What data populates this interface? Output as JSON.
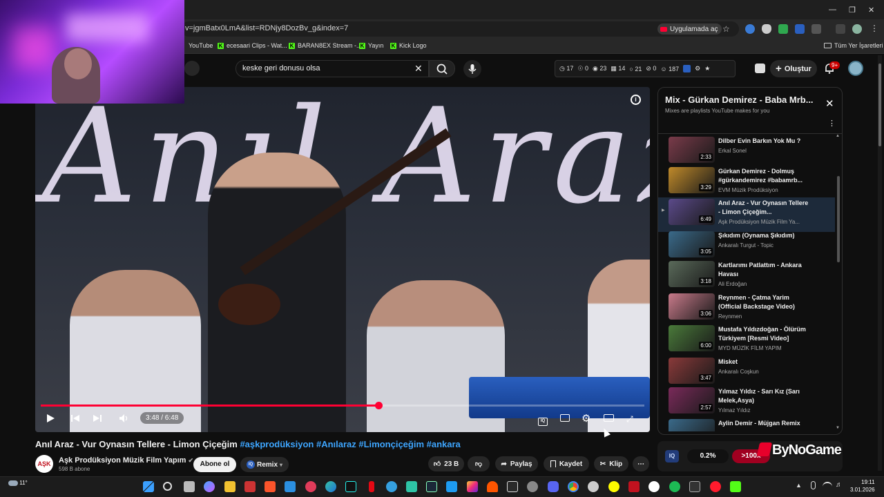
{
  "browser": {
    "url": "v=jgmBatx0LmA&list=RDNjy8DozBv_g&index=7",
    "open_in_app": "Uygulamada aç",
    "bookmarks": [
      "YouTube",
      "ecesaari Clips - Wat...",
      "BARAN8EX Stream -...",
      "Yayın",
      "Kick Logo"
    ],
    "all_bookmarks": "Tüm Yer İşaretleri"
  },
  "header": {
    "search_value": "keske geri donusu olsa",
    "stats": [
      "17",
      "0",
      "23",
      "14",
      "21",
      "0",
      "187"
    ],
    "create_label": "Oluştur",
    "notifications_count": "9+"
  },
  "video": {
    "title": "Anıl Araz - Vur Oynasın Tellere - Limon Çiçeğim",
    "hashtags": "#aşkprodüksiyon #Anılaraz #Limonçiçeğim #ankara",
    "overlay_text": "Anıl Araz",
    "time": "3:48 / 6:48",
    "progress_fraction": 0.559,
    "channel_logo": "AŞK",
    "channel_name": "Aşk Prodüksiyon Müzik Film Yapım",
    "subscribers": "598 B abone",
    "subscribe_label": "Abone ol",
    "remix_label": "Remix",
    "likes": "23 B",
    "share_label": "Paylaş",
    "save_label": "Kaydet",
    "clip_label": "Klip"
  },
  "playlist": {
    "title": "Mix - Gürkan Demirez - Baba Mrb...",
    "subtitle": "Mixes are playlists YouTube makes for you",
    "items": [
      {
        "title": "Dilber Evin Barkın Yok Mu ?",
        "channel": "Erkal Sonel",
        "duration": "2:33",
        "color": "#7a3b4a"
      },
      {
        "title": "Gürkan Demirez - Dolmuş #gürkandemirez #babamrb...",
        "channel": "EVM Müzik Prodüksiyon",
        "duration": "3:29",
        "color": "#c08a2a"
      },
      {
        "title": "Anıl Araz - Vur Oynasın Tellere - Limon Çiçeğim...",
        "channel": "Aşk Prodüksiyon Müzik Film Ya...",
        "duration": "6:49",
        "color": "#5b4a8a"
      },
      {
        "title": "Şıkıdım (Oynama Şıkıdım)",
        "channel": "Ankaralı Turgut - Topic",
        "duration": "3:05",
        "color": "#3a6a8a"
      },
      {
        "title": "Kartlarımı Patlattım - Ankara Havası",
        "channel": "Ali Erdoğan",
        "duration": "3:18",
        "color": "#5a6a5a"
      },
      {
        "title": "Reynmen - Çatma Yarim (Official Backstage Video)",
        "channel": "Reynmen",
        "duration": "3:06",
        "color": "#c87a8a"
      },
      {
        "title": "Mustafa Yıldızdoğan - Ölürüm Türkiyem [Resmi Video]",
        "channel": "MYD MÜZİK FİLM YAPIM",
        "duration": "6:00",
        "color": "#4a7a3a"
      },
      {
        "title": "Misket",
        "channel": "Ankaralı Coşkun",
        "duration": "3:47",
        "color": "#8a3a3a"
      },
      {
        "title": "Yılmaz Yıldız - Sarı Kız (Sarı Melek,Asya)",
        "channel": "Yılmaz Yıldız",
        "duration": "2:57",
        "color": "#7a2a5a"
      },
      {
        "title": "Aylin Demir - Müjgan Remix",
        "channel": "",
        "duration": "",
        "color": "#3a6a8a"
      }
    ]
  },
  "widgets": {
    "iq_label": "IQ",
    "iq_percent": "0.2%",
    "iq_hot": ">100x",
    "watermark": "ByNoGame"
  },
  "taskbar": {
    "weather": "11°",
    "time": "19:11",
    "date": "3.01.2026"
  },
  "colors": {
    "accent_red": "#ff0033",
    "link_blue": "#3ea6ff",
    "kick_green": "#53fc18"
  }
}
